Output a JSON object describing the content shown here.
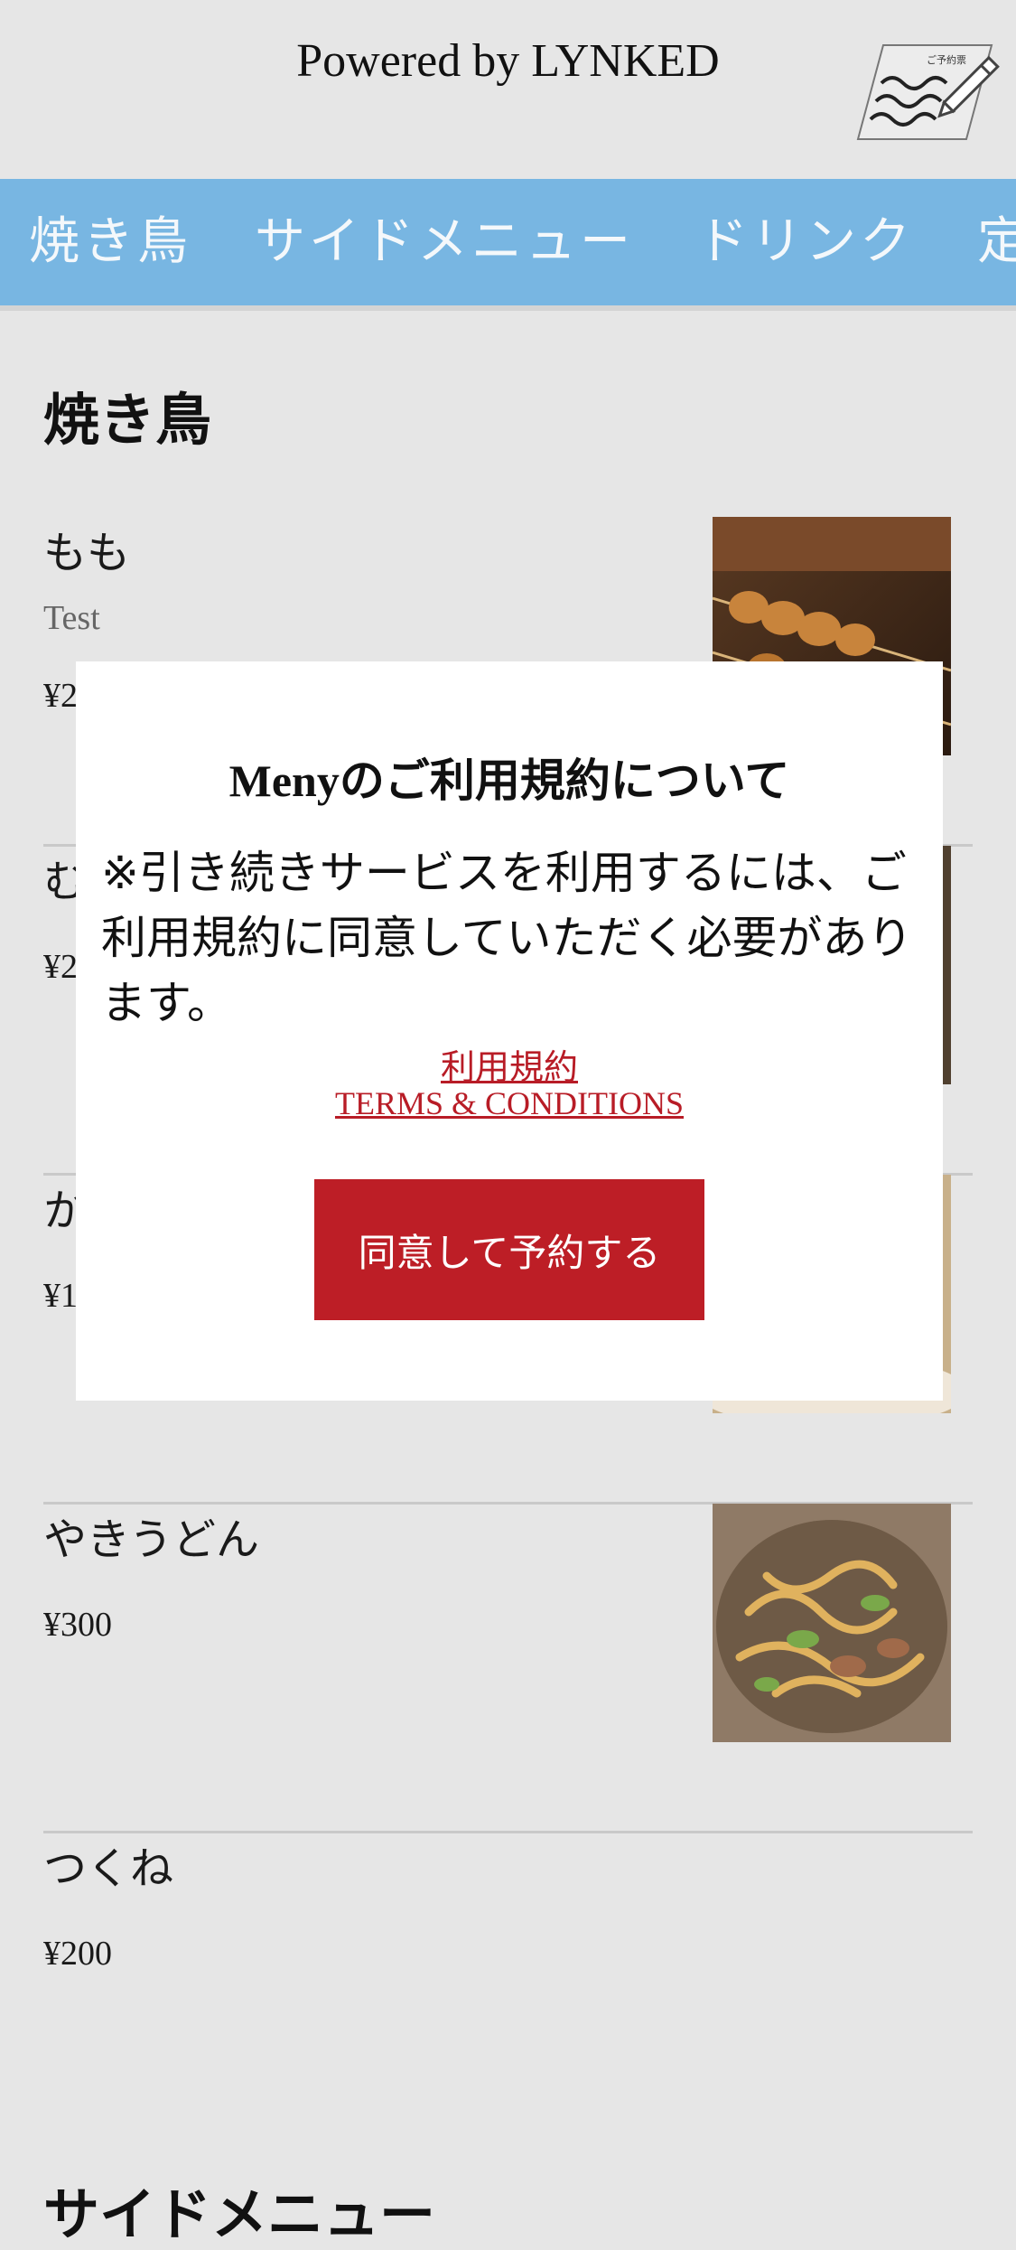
{
  "header": {
    "powered_by": "Powered by LYNKED",
    "reserve_icon_label": "ご予約票"
  },
  "tabs": [
    {
      "label": "焼き鳥"
    },
    {
      "label": "サイドメニュー"
    },
    {
      "label": "ドリンク"
    },
    {
      "label": "定食"
    }
  ],
  "sections": [
    {
      "title": "焼き鳥",
      "items": [
        {
          "name": "もも",
          "description": "Test",
          "price": "¥2",
          "image": "yakitori-momo"
        },
        {
          "name": "む",
          "price": "¥2",
          "image": "yakitori-mune"
        },
        {
          "name": "か",
          "price": "¥1",
          "image": "karaage"
        },
        {
          "name": "やきうどん",
          "price": "¥300",
          "image": "yaki-udon"
        },
        {
          "name": "つくね",
          "price": "¥200"
        }
      ]
    },
    {
      "title": "サイドメニュー"
    }
  ],
  "modal": {
    "title": "Menyのご利用規約について",
    "body": "※引き続きサービスを利用するには、ご利用規約に同意していただく必要があります。",
    "terms_link_jp": "利用規約",
    "terms_link_en": "TERMS & CONDITIONS",
    "agree_button": "同意して予約する"
  },
  "colors": {
    "tab_bar": "#78b6e2",
    "accent_red": "#bd1e26",
    "background": "#e6e6e6"
  }
}
